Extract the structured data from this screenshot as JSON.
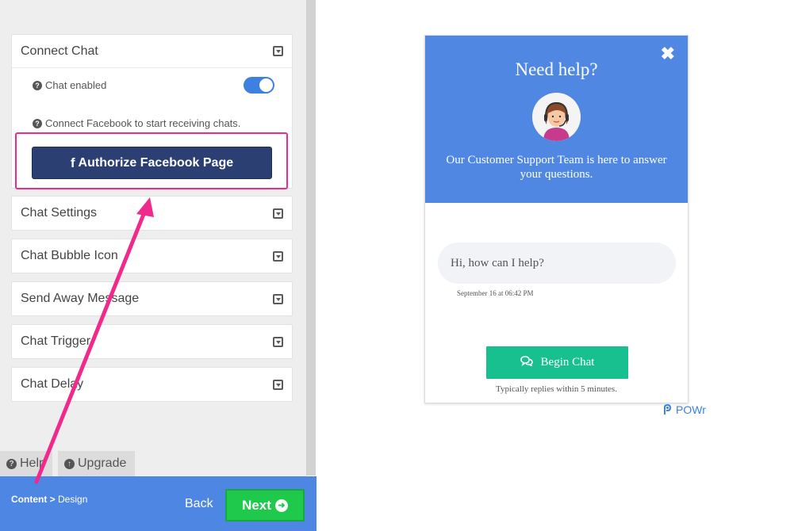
{
  "editor": {
    "connect_section": {
      "title": "Connect Chat",
      "chat_enabled_label": "Chat enabled",
      "chat_enabled": true,
      "connect_hint": "Connect Facebook to start receiving chats.",
      "authorize_button": "Authorize Facebook Page"
    },
    "sections": [
      {
        "title": "Chat Settings"
      },
      {
        "title": "Chat Bubble Icon"
      },
      {
        "title": "Send Away Message"
      },
      {
        "title": "Chat Trigger"
      },
      {
        "title": "Chat Delay"
      }
    ],
    "tabs": {
      "help": "Help",
      "upgrade": "Upgrade"
    },
    "footer": {
      "crumb_current": "Content >",
      "crumb_next": "Design",
      "back": "Back",
      "next": "Next"
    }
  },
  "preview": {
    "title": "Need help?",
    "subtitle": "Our Customer Support Team is here to answer your questions.",
    "message": "Hi, how can I help?",
    "message_time": "September 16 at 06:42 PM",
    "begin_button": "Begin Chat",
    "reply_note": "Typically replies within 5 minutes.",
    "brand": "POWr"
  },
  "colors": {
    "accent": "#4f87e3",
    "facebook": "#2b3f73",
    "next": "#1ec94c",
    "begin": "#18c08f",
    "annotation": "#ef2a8c"
  },
  "icons": {
    "close": "close-icon",
    "help": "question-circle-icon",
    "upgrade": "arrow-up-circle-icon",
    "chat": "chat-bubbles-icon",
    "caret": "caret-square-down-icon",
    "facebook": "facebook-f-icon"
  }
}
